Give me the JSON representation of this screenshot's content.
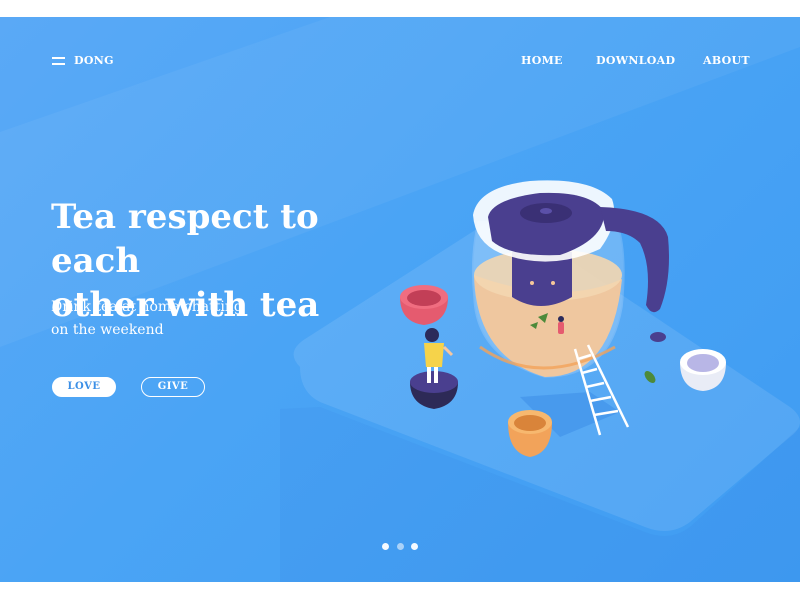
{
  "header": {
    "menu_icon": "hamburger-icon",
    "brand": "DONG",
    "nav": [
      {
        "label": "HOME"
      },
      {
        "label": "DOWNLOAD"
      },
      {
        "label": "ABOUT"
      }
    ]
  },
  "hero": {
    "headline_line1": "Tea respect to each",
    "headline_line2": "other with tea",
    "subtitle_line1": "Drink tea at home chatting",
    "subtitle_line2": "on the weekend",
    "buttons": {
      "love": "LOVE",
      "give": "GIVE"
    }
  },
  "carousel": {
    "slide_count": 3,
    "active_index": 2
  },
  "colors": {
    "background": "#4aa4f5",
    "text": "#ffffff",
    "teapot_lid": "#4a3f8f",
    "tea": "#f6c79a",
    "accent_red": "#e55b6f",
    "accent_orange": "#f2a35a"
  }
}
